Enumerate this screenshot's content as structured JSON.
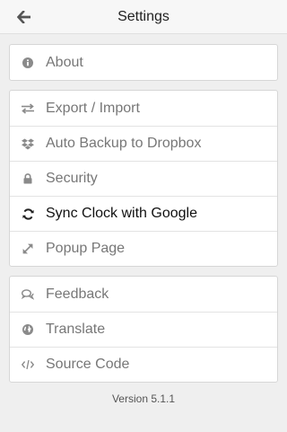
{
  "header": {
    "title": "Settings"
  },
  "groups": [
    {
      "items": [
        {
          "label": "About",
          "icon": "info-icon"
        }
      ]
    },
    {
      "items": [
        {
          "label": "Export / Import",
          "icon": "swap-arrows-icon"
        },
        {
          "label": "Auto Backup to Dropbox",
          "icon": "dropbox-icon"
        },
        {
          "label": "Security",
          "icon": "lock-icon"
        },
        {
          "label": "Sync Clock with Google",
          "icon": "refresh-icon",
          "active": true
        },
        {
          "label": "Popup Page",
          "icon": "expand-icon"
        }
      ]
    },
    {
      "items": [
        {
          "label": "Feedback",
          "icon": "comments-icon"
        },
        {
          "label": "Translate",
          "icon": "globe-icon"
        },
        {
          "label": "Source Code",
          "icon": "code-icon"
        }
      ]
    }
  ],
  "footer": {
    "version": "Version 5.1.1"
  },
  "colors": {
    "background": "#efefef",
    "panel": "#ffffff",
    "icon": "#8a8a8a",
    "active_icon": "#222222"
  }
}
